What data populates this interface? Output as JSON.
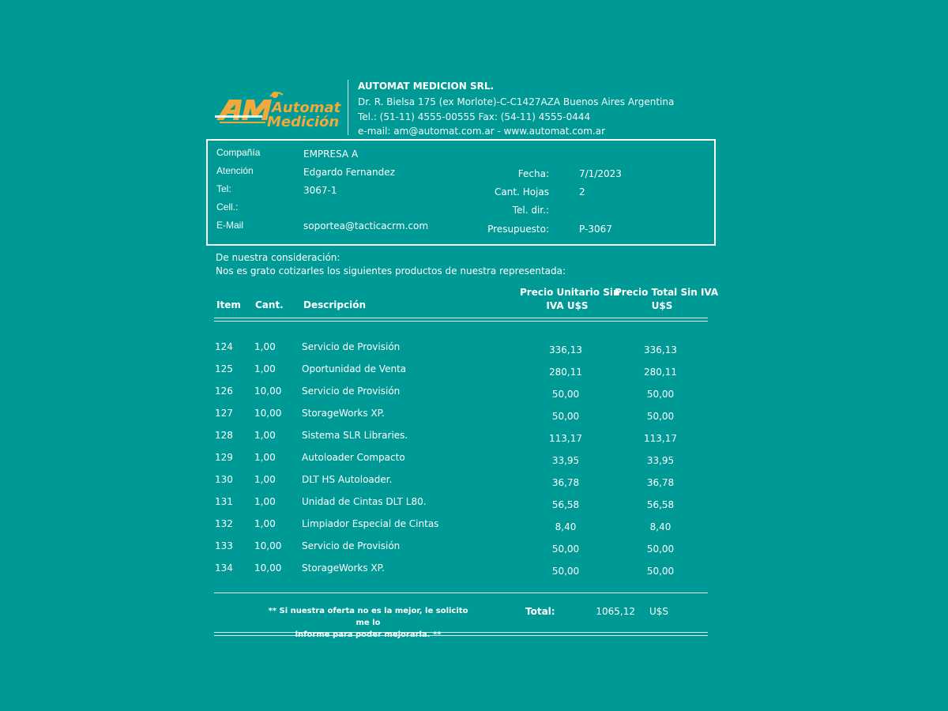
{
  "company": {
    "logo_text_line1": "Automat",
    "logo_text_line2": "Medición",
    "logo_mark": "AM",
    "name": "AUTOMAT MEDICION SRL.",
    "address": "Dr. R. Bielsa 175 (ex Morlote)-C-C1427AZA Buenos Aires Argentina",
    "phone": "Tel.: (51-11) 4555-00555 Fax: (54-11) 4555-0444",
    "contact": "e-mail: am@automat.com.ar - www.automat.com.ar"
  },
  "client": {
    "labels": {
      "company": "Compañía",
      "attention": "Atención",
      "tel": "Tel:",
      "cell": "Cell.:",
      "email": "E-Mail"
    },
    "company": "EMPRESA A",
    "attention": "Edgardo Fernandez",
    "tel": "3067-1",
    "cell": "",
    "email": "soportea@tacticacrm.com"
  },
  "quote_meta": {
    "labels": {
      "date": "Fecha:",
      "pages": "Cant. Hojas",
      "direct_tel": "Tel. dir.:",
      "budget": "Presupuesto:"
    },
    "date": "7/1/2023",
    "pages": "2",
    "direct_tel": "",
    "budget": "P-3067"
  },
  "intro": {
    "line1": "De nuestra consideración:",
    "line2": "Nos es grato cotizarles los siguientes productos de nuestra representada:"
  },
  "table": {
    "headers": {
      "item": "Item",
      "qty": "Cant.",
      "description": "Descripción",
      "unit_price_1": "Precio Unitario Sin",
      "unit_price_2": "IVA U$S",
      "total_price_1": "Precio Total Sin IVA",
      "total_price_2": "U$S"
    },
    "rows": [
      {
        "item": "124",
        "qty": "1,00",
        "description": "Servicio de Provisión",
        "unit": "336,13",
        "total": "336,13"
      },
      {
        "item": "125",
        "qty": "1,00",
        "description": "Oportunidad de Venta",
        "unit": "280,11",
        "total": "280,11"
      },
      {
        "item": "126",
        "qty": "10,00",
        "description": "Servicio de Provisión",
        "unit": "50,00",
        "total": "50,00"
      },
      {
        "item": "127",
        "qty": "10,00",
        "description": "StorageWorks XP.",
        "unit": "50,00",
        "total": "50,00"
      },
      {
        "item": "128",
        "qty": "1,00",
        "description": "Sistema SLR Libraries.",
        "unit": "113,17",
        "total": "113,17"
      },
      {
        "item": "129",
        "qty": "1,00",
        "description": "Autoloader Compacto",
        "unit": "33,95",
        "total": "33,95"
      },
      {
        "item": "130",
        "qty": "1,00",
        "description": "DLT HS Autoloader.",
        "unit": "36,78",
        "total": "36,78"
      },
      {
        "item": "131",
        "qty": "1,00",
        "description": "Unidad de Cintas DLT L80.",
        "unit": "56,58",
        "total": "56,58"
      },
      {
        "item": "132",
        "qty": "1,00",
        "description": "Limpiador Especial de Cintas",
        "unit": "8,40",
        "total": "8,40"
      },
      {
        "item": "133",
        "qty": "10,00",
        "description": "Servicio de Provisión",
        "unit": "50,00",
        "total": "50,00"
      },
      {
        "item": "134",
        "qty": "10,00",
        "description": "StorageWorks XP.",
        "unit": "50,00",
        "total": "50,00"
      }
    ]
  },
  "footer": {
    "note_line1": "** Si nuestra oferta no es la mejor, le solicito me lo",
    "note_line2": "informe para poder mejorarla. **",
    "total_label": "Total:",
    "total_value": "1065,12",
    "currency": "U$S"
  },
  "colors": {
    "background": "#009a96",
    "text": "#ffffff",
    "logo_orange": "#f2a93b"
  }
}
